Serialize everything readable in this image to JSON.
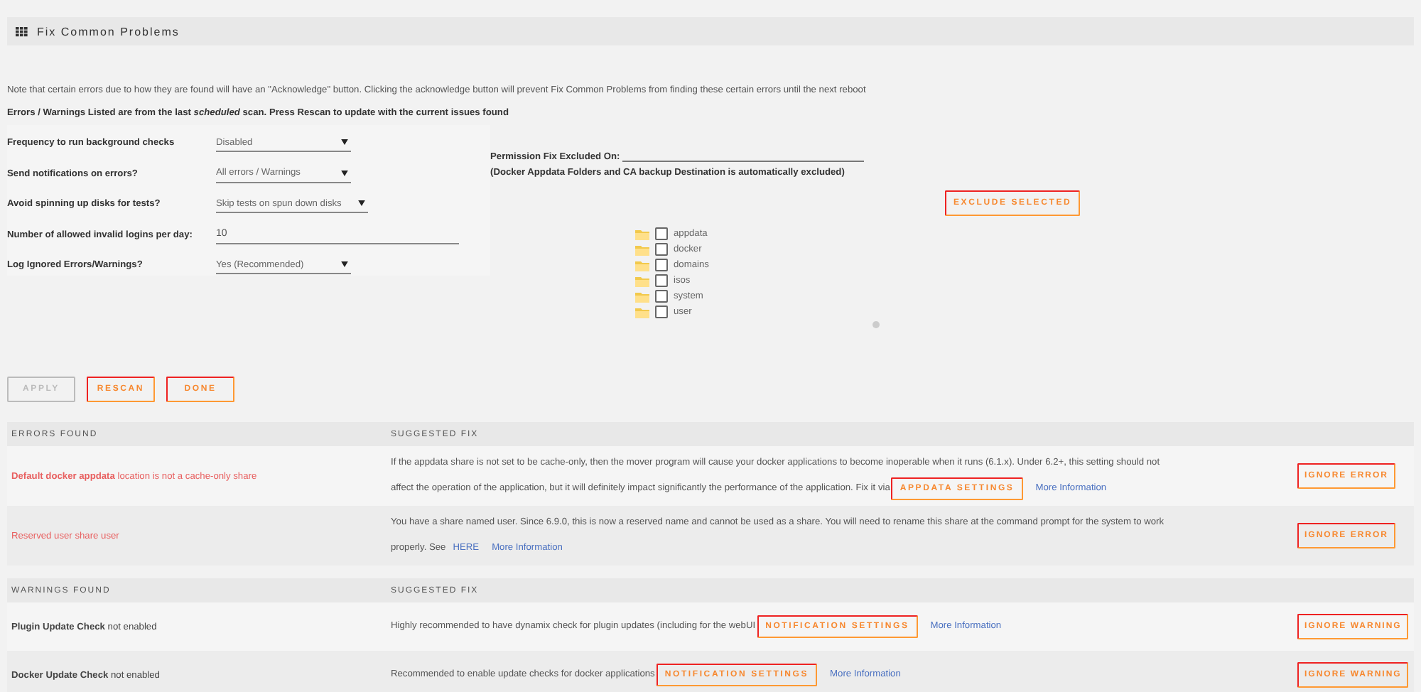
{
  "title": "Fix Common Problems",
  "note": "Note that certain errors due to how they are found will have an \"Acknowledge\" button. Clicking the acknowledge button will prevent Fix Common Problems from finding these certain errors until the next reboot",
  "scan_note": "Errors / Warnings Listed are from the last *scheduled* scan. Press Rescan to update with the current issues found",
  "settings": [
    {
      "label": "Frequency to run background checks",
      "kind": "select",
      "value": "Disabled"
    },
    {
      "label": "Send notifications on errors?",
      "kind": "select",
      "value": "All errors / Warnings"
    },
    {
      "label": "Avoid spinning up disks for tests?",
      "kind": "select",
      "value": "Skip tests on spun down disks"
    },
    {
      "label": "Number of allowed invalid logins per day:",
      "kind": "input",
      "value": "10"
    },
    {
      "label": "Log Ignored Errors/Warnings?",
      "kind": "select",
      "value": "Yes (Recommended)"
    }
  ],
  "permission": {
    "label": "Permission Fix Excluded On:",
    "note": "(Docker Appdata Folders and CA backup Destination is automatically excluded)",
    "button": "EXCLUDE SELECTED",
    "folders": [
      {
        "name": "appdata",
        "checked": false
      },
      {
        "name": "docker",
        "checked": false
      },
      {
        "name": "domains",
        "checked": false
      },
      {
        "name": "isos",
        "checked": false
      },
      {
        "name": "system",
        "checked": false
      },
      {
        "name": "user",
        "checked": false
      }
    ]
  },
  "buttons": [
    {
      "label": "APPLY",
      "disabled": true
    },
    {
      "label": "RESCAN",
      "disabled": false
    },
    {
      "label": "DONE",
      "disabled": false
    }
  ],
  "sections": [
    {
      "kind": "error",
      "heading": "ERRORS FOUND",
      "fix_heading": "SUGGESTED FIX",
      "rows": [
        {
          "issue": "**Default docker appdata** location is not a cache-only share",
          "ignore": "IGNORE ERROR",
          "fix": [
            {
              "kind": "text",
              "text": "If the appdata share is not set to be cache-only, then the mover program will cause your docker applications to become inoperable when it runs (6.1.x). Under 6.2+, this setting should not"
            },
            {
              "kind": "text",
              "text": "affect the operation of the application, but it will definitely impact significantly the performance of the application. Fix it via"
            },
            {
              "kind": "button",
              "text": "APPDATA SETTINGS"
            },
            {
              "kind": "link",
              "text": "More Information"
            }
          ]
        },
        {
          "issue": "Reserved user share user",
          "ignore": "IGNORE ERROR",
          "fix": [
            {
              "kind": "text",
              "text": "You have a share named user. Since 6.9.0, this is now a reserved name and cannot be used as a share. You will need to rename this share at the command prompt for the system to work"
            },
            {
              "kind": "text",
              "text": "properly. See"
            },
            {
              "kind": "link",
              "text": "HERE"
            },
            {
              "kind": "link",
              "text": "More Information"
            }
          ]
        }
      ]
    },
    {
      "kind": "warning",
      "heading": "WARNINGS FOUND",
      "fix_heading": "SUGGESTED FIX",
      "rows": [
        {
          "issue": "**Plugin Update Check** not enabled",
          "ignore": "IGNORE WARNING",
          "fix": [
            {
              "kind": "text",
              "text": "Highly recommended to have dynamix check for plugin updates (including for the webUI"
            },
            {
              "kind": "button",
              "text": "NOTIFICATION SETTINGS"
            },
            {
              "kind": "link",
              "text": "More Information"
            }
          ]
        },
        {
          "issue": "**Docker Update Check** not enabled",
          "ignore": "IGNORE WARNING",
          "fix": [
            {
              "kind": "text",
              "text": "Recommended to enable update checks for docker applications"
            },
            {
              "kind": "button",
              "text": "NOTIFICATION SETTINGS"
            },
            {
              "kind": "link",
              "text": "More Information"
            }
          ]
        }
      ]
    }
  ]
}
